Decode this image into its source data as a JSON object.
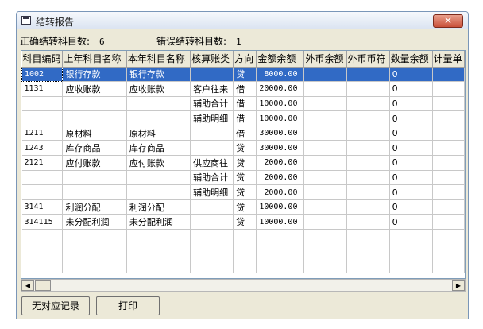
{
  "window": {
    "title": "结转报告"
  },
  "summary": {
    "correct_label": "正确结转科目数:",
    "correct_value": "6",
    "error_label": "错误结转科目数:",
    "error_value": "1"
  },
  "table": {
    "columns": [
      "科目编码",
      "上年科目名称",
      "本年科目名称",
      "核算账类",
      "方向",
      "金额余额",
      "外币余额",
      "外币币符",
      "数量余额",
      "计量单"
    ],
    "rows": [
      [
        "1002",
        "银行存款",
        "银行存款",
        "",
        "贷",
        "8000.00",
        "",
        "",
        "0",
        ""
      ],
      [
        "1131",
        "应收账款",
        "应收账款",
        "客户往来",
        "借",
        "20000.00",
        "",
        "",
        "0",
        ""
      ],
      [
        "",
        "",
        "",
        "辅助合计",
        "借",
        "10000.00",
        "",
        "",
        "0",
        ""
      ],
      [
        "",
        "",
        "",
        "辅助明细",
        "借",
        "10000.00",
        "",
        "",
        "0",
        ""
      ],
      [
        "1211",
        "原材料",
        "原材料",
        "",
        "借",
        "30000.00",
        "",
        "",
        "0",
        ""
      ],
      [
        "1243",
        "库存商品",
        "库存商品",
        "",
        "贷",
        "30000.00",
        "",
        "",
        "0",
        ""
      ],
      [
        "2121",
        "应付账款",
        "应付账款",
        "供应商往",
        "贷",
        "2000.00",
        "",
        "",
        "0",
        ""
      ],
      [
        "",
        "",
        "",
        "辅助合计",
        "贷",
        "2000.00",
        "",
        "",
        "0",
        ""
      ],
      [
        "",
        "",
        "",
        "辅助明细",
        "贷",
        "2000.00",
        "",
        "",
        "0",
        ""
      ],
      [
        "3141",
        "利润分配",
        "利润分配",
        "",
        "贷",
        "10000.00",
        "",
        "",
        "0",
        ""
      ],
      [
        "314115",
        "未分配利润",
        "未分配利润",
        "",
        "贷",
        "10000.00",
        "",
        "",
        "0",
        ""
      ]
    ],
    "selected_row": 0
  },
  "scrollbar": {
    "left_arrow": "◀",
    "right_arrow": "▶"
  },
  "buttons": {
    "no_match": "无对应记录",
    "print": "打印"
  },
  "close_glyph": "✕",
  "colors": {
    "selection": "#316ac5",
    "close_button": "#c9503a"
  }
}
